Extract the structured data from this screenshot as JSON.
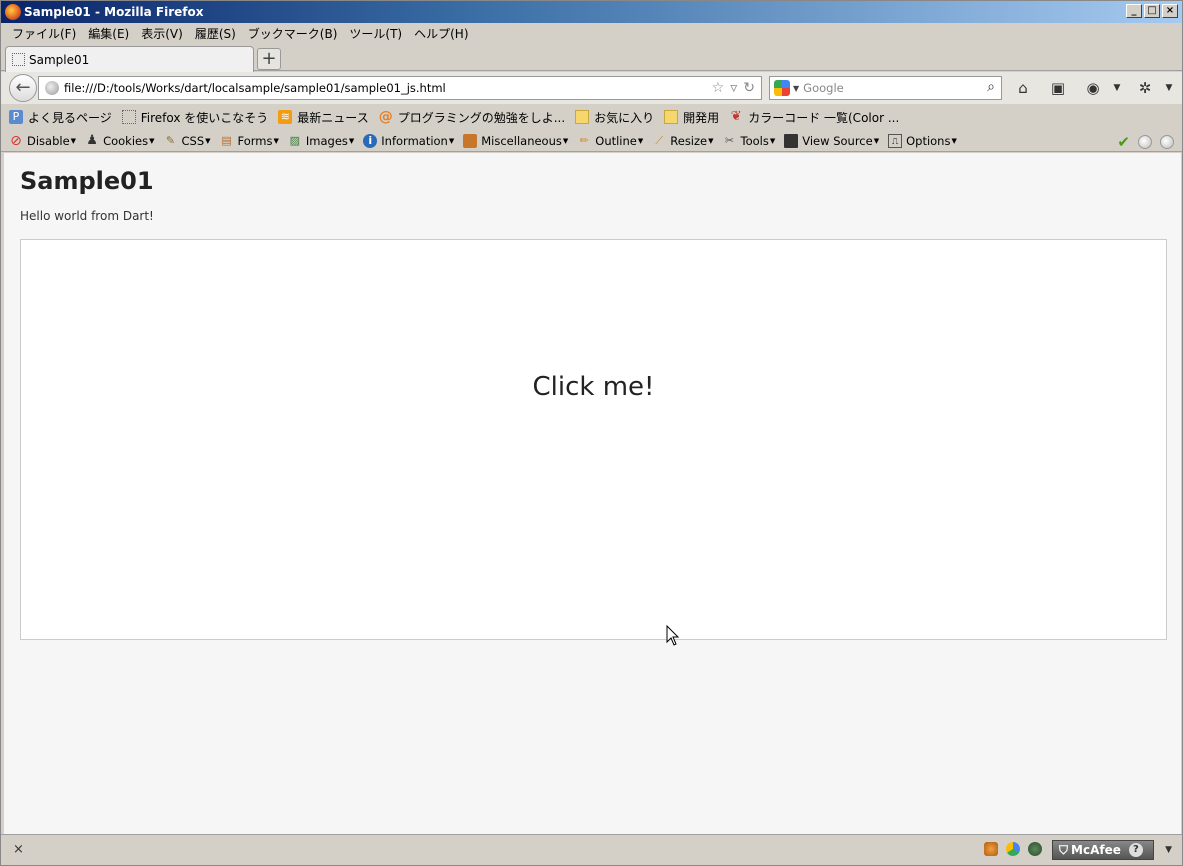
{
  "window": {
    "title": "Sample01 - Mozilla Firefox"
  },
  "menu": [
    "ファイル(F)",
    "編集(E)",
    "表示(V)",
    "履歴(S)",
    "ブックマーク(B)",
    "ツール(T)",
    "ヘルプ(H)"
  ],
  "tab": {
    "label": "Sample01",
    "new_tab": "+"
  },
  "nav": {
    "url": "file:///D:/tools/Works/dart/localsample/sample01/sample01_js.html",
    "search_placeholder": "Google"
  },
  "bookmarks": [
    "よく見るページ",
    "Firefox を使いこなそう",
    "最新ニュース",
    "プログラミングの勉強をしよ...",
    "お気に入り",
    "開発用",
    "カラーコード 一覧(Color ..."
  ],
  "devtoolbar": [
    "Disable",
    "Cookies",
    "CSS",
    "Forms",
    "Images",
    "Information",
    "Miscellaneous",
    "Outline",
    "Resize",
    "Tools",
    "View Source",
    "Options"
  ],
  "page": {
    "heading": "Sample01",
    "text": "Hello world from Dart!",
    "button_text": "Click me!"
  },
  "status": {
    "close": "×",
    "mcafee": "McAfee",
    "help": "?"
  },
  "colors": {
    "titlebar": "#0a246a",
    "content_bg": "#f6f6f6",
    "box_bg": "#ffffff"
  }
}
